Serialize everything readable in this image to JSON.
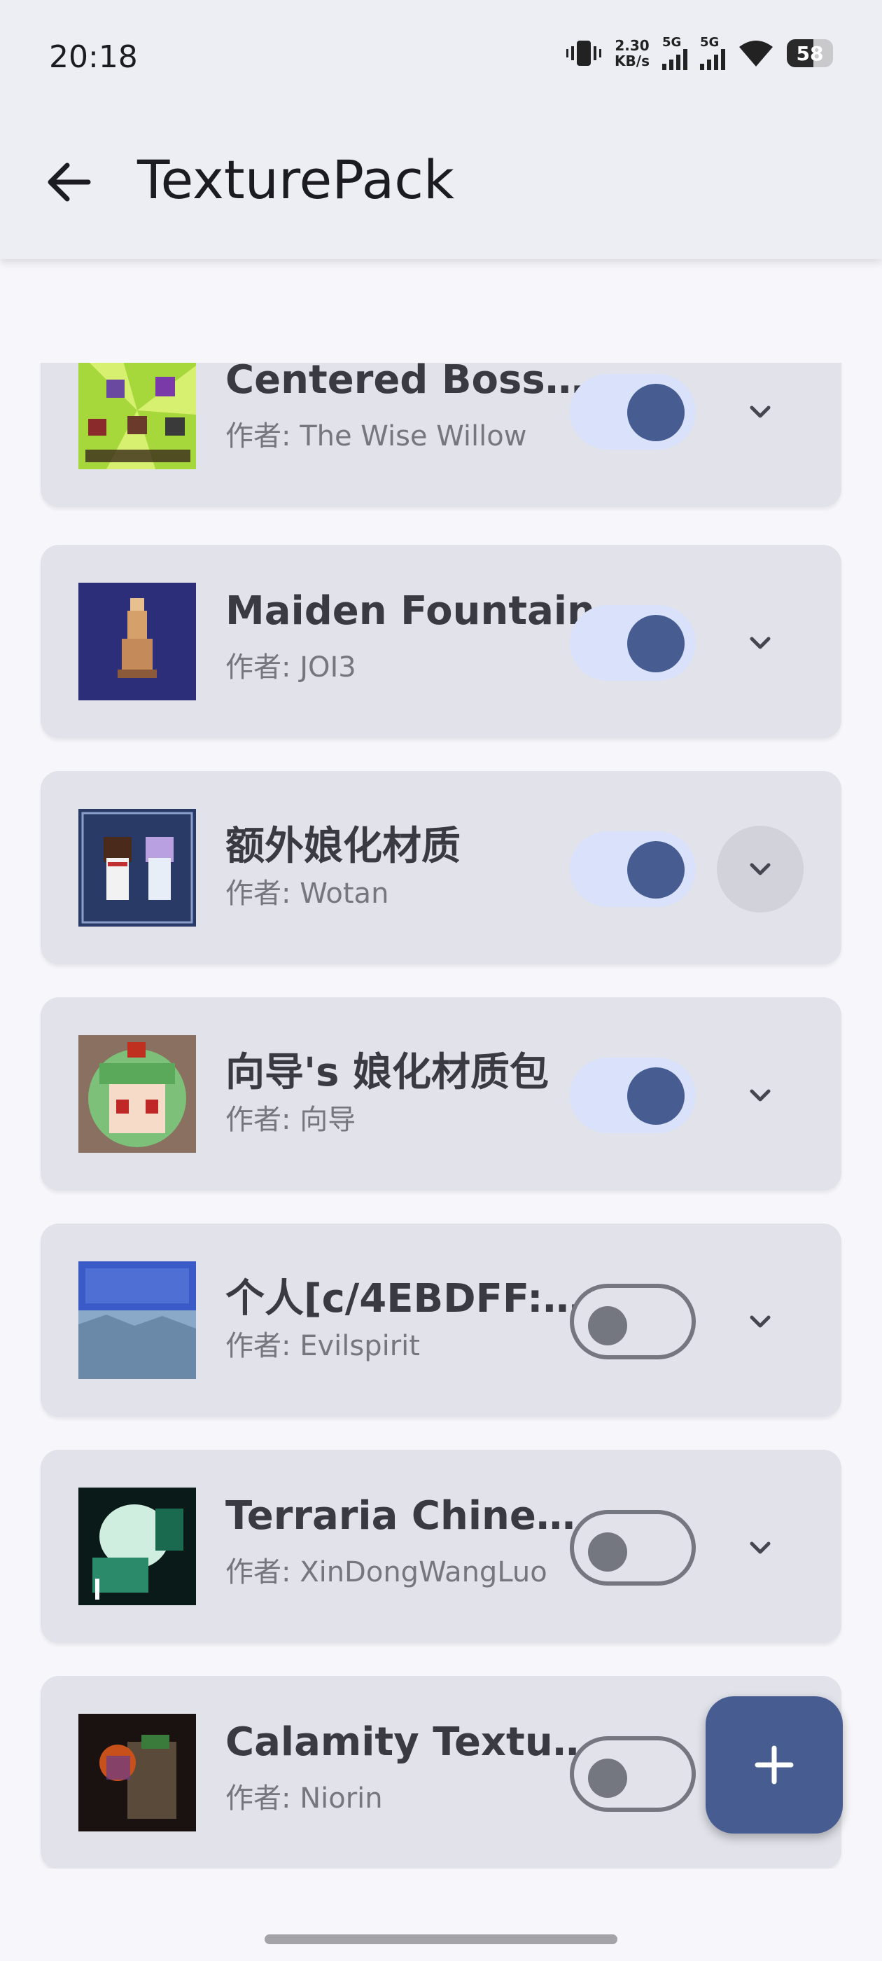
{
  "status_bar": {
    "time": "20:18",
    "net_speed_value": "2.30",
    "net_speed_unit": "KB/s",
    "sim1_label": "5G",
    "sim2_label": "5G",
    "battery_level": "58",
    "icons": [
      "vibrate-icon",
      "signal-icon",
      "signal-icon",
      "wifi-icon",
      "battery-icon"
    ]
  },
  "app_bar": {
    "title": "TexturePack",
    "back_icon": "arrow-left-icon"
  },
  "packs": [
    {
      "name": "Centered Boss …",
      "author": "作者: The Wise Willow",
      "enabled": true,
      "expand_active": false
    },
    {
      "name": "Maiden Fountain",
      "author": "作者: JOI3",
      "enabled": true,
      "expand_active": false
    },
    {
      "name": "额外娘化材质",
      "author": "作者: Wotan",
      "enabled": true,
      "expand_active": true
    },
    {
      "name": "向导's 娘化材质包",
      "author": "作者: 向导",
      "enabled": true,
      "expand_active": false
    },
    {
      "name": "个人[c/4EBDFF:…",
      "author": "作者: Evilspirit",
      "enabled": false,
      "expand_active": false
    },
    {
      "name": "Terraria Chines…",
      "author": "作者: XinDongWangLuo",
      "enabled": false,
      "expand_active": false
    },
    {
      "name": "Calamity Textur…",
      "author": "作者: Niorin",
      "enabled": false,
      "expand_active": false
    }
  ],
  "fab": {
    "icon": "plus-icon"
  },
  "colors": {
    "primary": "#475d92",
    "toggle_track_on": "#dae2fb",
    "card_bg": "#e1e2ea",
    "outline": "#74777f"
  }
}
